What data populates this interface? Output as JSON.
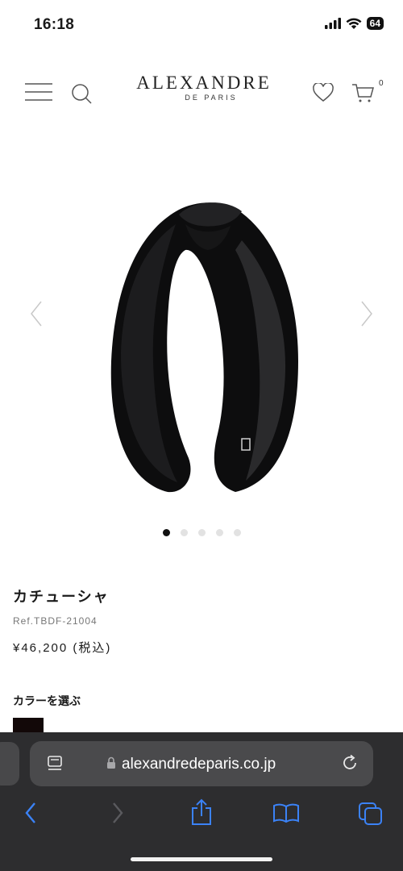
{
  "status_bar": {
    "time": "16:18",
    "battery": "64"
  },
  "header": {
    "logo_main": "ALEXANDRE",
    "logo_sub": "DE PARIS",
    "cart_count": "0"
  },
  "gallery": {
    "slide_count": 5,
    "active_slide": 1
  },
  "product": {
    "title": "カチューシャ",
    "ref": "Ref.TBDF-21004",
    "price": "¥46,200 (税込)",
    "color_label": "カラーを選ぶ",
    "color_swatch": "#120808"
  },
  "browser": {
    "url": "alexandredeparis.co.jp",
    "accent": "#3b82f6"
  }
}
